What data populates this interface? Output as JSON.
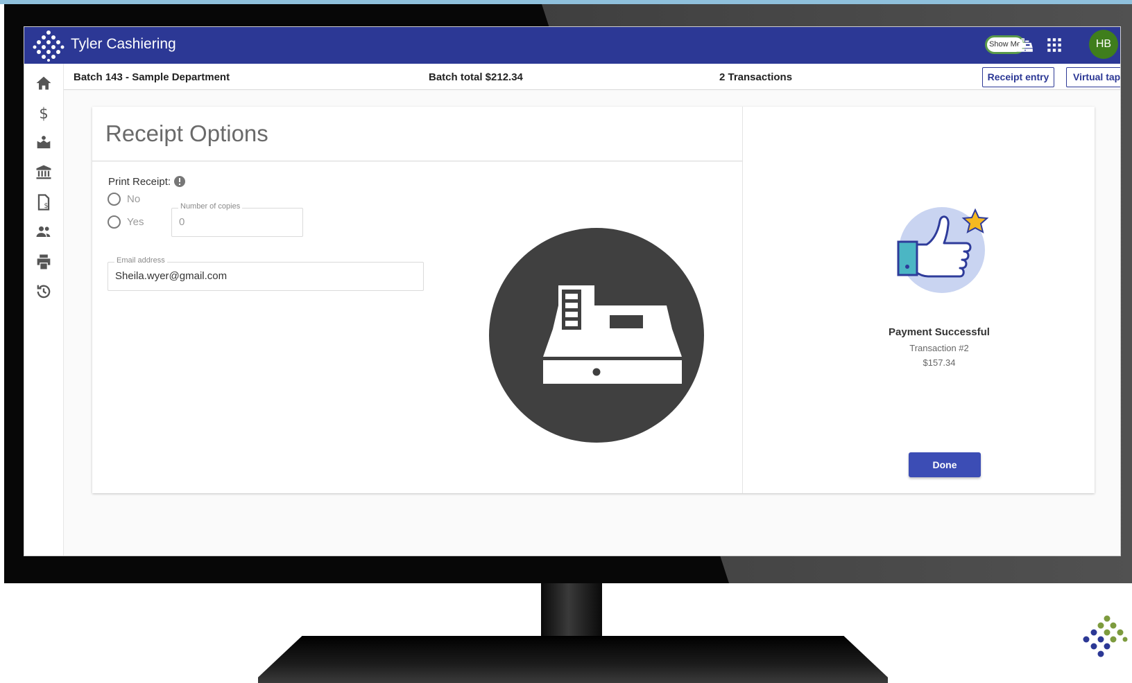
{
  "app": {
    "title": "Tyler Cashiering",
    "show_me_label": "Show Me",
    "avatar_initials": "HB",
    "brand_color": "#2c3895",
    "avatar_color": "#3f7e1c"
  },
  "sidebar": {
    "items": [
      {
        "icon": "home-icon"
      },
      {
        "icon": "dollar-icon"
      },
      {
        "icon": "deposit-icon"
      },
      {
        "icon": "bank-icon"
      },
      {
        "icon": "invoice-icon"
      },
      {
        "icon": "people-icon"
      },
      {
        "icon": "printer-icon"
      },
      {
        "icon": "history-icon"
      }
    ]
  },
  "batch": {
    "name": "Batch 143 - Sample Department",
    "total": "Batch total $212.34",
    "transactions": "2 Transactions",
    "receipt_entry_label": "Receipt entry",
    "virtual_tape_label": "Virtual tape"
  },
  "receipt_options": {
    "title": "Receipt Options",
    "print_receipt_label": "Print Receipt:",
    "options": [
      {
        "label": "No",
        "selected": false
      },
      {
        "label": "Yes",
        "selected": false
      }
    ],
    "copies_label": "Number of copies",
    "copies_value": "0",
    "email_label": "Email address",
    "email_value": "Sheila.wyer@gmail.com"
  },
  "payment": {
    "status": "Payment Successful",
    "transaction": "Transaction #2",
    "amount": "$157.34",
    "done_label": "Done"
  }
}
